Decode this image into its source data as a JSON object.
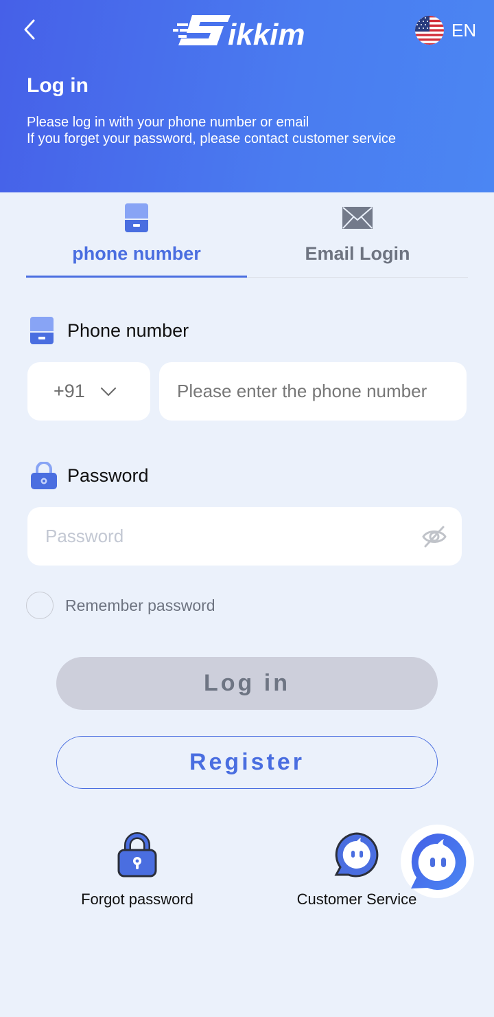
{
  "header": {
    "back_icon": "chevron-left-icon",
    "brand": "Sikkim",
    "language": {
      "flag_icon": "us-flag-icon",
      "code": "EN"
    },
    "title": "Log in",
    "subtitle_line1": "Please log in with your phone number or email",
    "subtitle_line2": "If you forget your password, please contact customer service"
  },
  "tabs": [
    {
      "label": "phone number",
      "icon": "phone-icon",
      "active": true
    },
    {
      "label": "Email Login",
      "icon": "envelope-icon",
      "active": false
    }
  ],
  "phone_field": {
    "label": "Phone number",
    "country_code": "+91",
    "value": "",
    "placeholder": "Please enter the phone number"
  },
  "password_field": {
    "label": "Password",
    "value": "",
    "placeholder": "Password",
    "visibility_icon": "eye-off-icon"
  },
  "remember": {
    "label": "Remember password",
    "checked": false
  },
  "buttons": {
    "login": "Log in",
    "register": "Register"
  },
  "links": {
    "forgot_password": "Forgot password",
    "customer_service": "Customer Service"
  },
  "colors": {
    "accent": "#4a6ee0",
    "header_gradient_start": "#4660e8",
    "header_gradient_end": "#4b86f3",
    "background": "#ebf1fb",
    "disabled_button": "#cdcfdb"
  }
}
